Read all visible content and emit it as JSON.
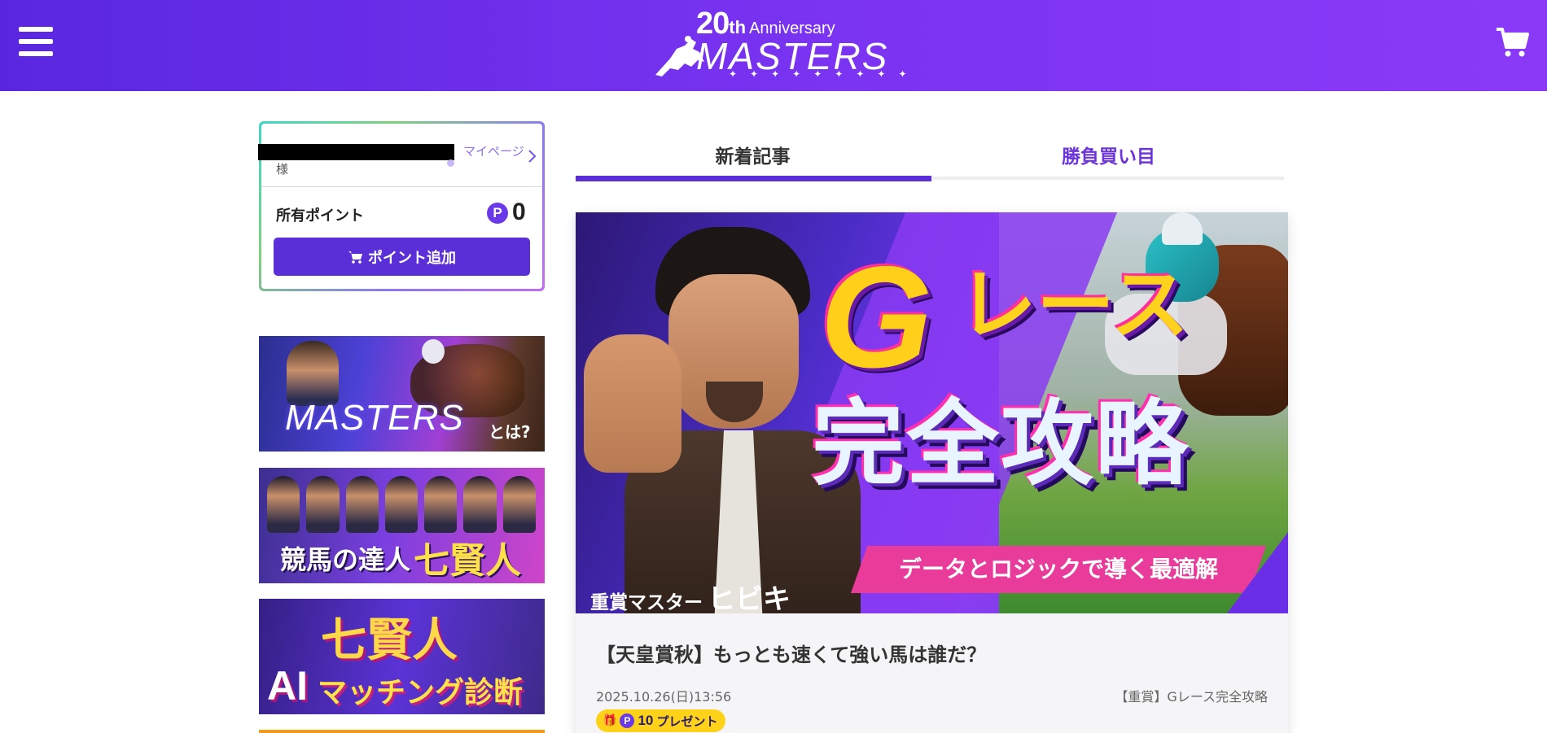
{
  "header": {
    "logo_number": "20",
    "logo_th": "th",
    "logo_anniversary": "Anniversary",
    "logo_wordmark": "MASTERS",
    "logo_stars": "✦✦✦✦✦✦✦✦✦",
    "menu_icon": "hamburger-icon",
    "cart_icon": "cart-icon",
    "brand_color": "#7b34f2"
  },
  "user_card": {
    "name_suffix": "様",
    "mypage_label": "マイページ",
    "points_label": "所有ポイント",
    "points_badge": "P",
    "points_value": "0",
    "add_points_label": "ポイント追加",
    "accent_color": "#5a2fd8"
  },
  "banners": [
    {
      "text": "MASTERS",
      "suffix": "とは?"
    },
    {
      "text": "競馬の達人",
      "highlight": "七賢人"
    },
    {
      "text": "七賢人",
      "sub_ai": "AI",
      "sub": "マッチング診断"
    }
  ],
  "tabs": [
    {
      "label": "新着記事",
      "active": true
    },
    {
      "label": "勝負買い目",
      "active": false
    }
  ],
  "article": {
    "hero_g": "G",
    "hero_race": "レース",
    "hero_main": "完全攻略",
    "hero_tagline": "データとロジックで導く最適解",
    "hero_master_prefix": "重賞マスター",
    "hero_master_name": "ヒビキ",
    "title": "【天皇賞秋】もっとも速くて強い馬は誰だ？",
    "date": "2025.10.26(日)13:56",
    "category": "【重賞】Gレース完全攻略",
    "present_points": "10",
    "present_label": "プレゼント",
    "present_badge": "P"
  }
}
